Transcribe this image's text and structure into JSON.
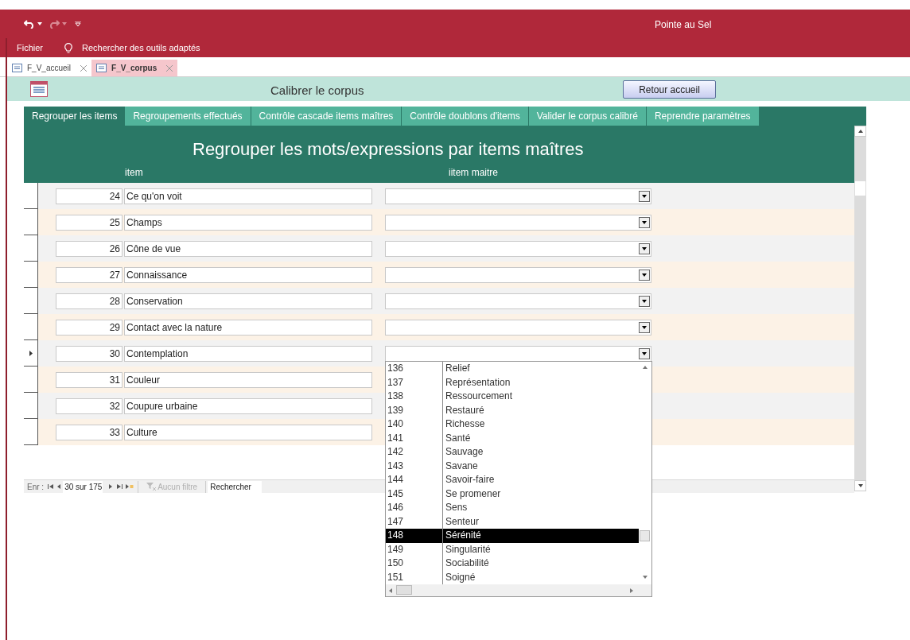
{
  "title_bar": {
    "title": "Pointe au Sel"
  },
  "ribbon": {
    "file_menu": "Fichier",
    "search_hint": "Rechercher des outils adaptés"
  },
  "document_tabs": [
    {
      "label": "F_V_accueil",
      "selected": false
    },
    {
      "label": "F_V_corpus",
      "selected": true
    }
  ],
  "form_header": {
    "title": "Calibrer le corpus",
    "button": "Retour accueil"
  },
  "tabs": [
    {
      "label": "Regrouper les items",
      "selected": true
    },
    {
      "label": "Regroupements effectués",
      "selected": false
    },
    {
      "label": "Contrôle cascade items maîtres",
      "selected": false
    },
    {
      "label": "Contrôle doublons d'items",
      "selected": false
    },
    {
      "label": "Valider le corpus calibré",
      "selected": false
    },
    {
      "label": "Reprendre paramètres",
      "selected": false
    }
  ],
  "form": {
    "title": "Regrouper les mots/expressions par items maîtres",
    "columns": [
      "item",
      "iitem maitre"
    ],
    "rows": [
      {
        "number": "24",
        "text": "Ce qu'on voit",
        "current": false
      },
      {
        "number": "25",
        "text": "Champs",
        "current": false
      },
      {
        "number": "26",
        "text": "Cône de vue",
        "current": false
      },
      {
        "number": "27",
        "text": "Connaissance",
        "current": false
      },
      {
        "number": "28",
        "text": "Conservation",
        "current": false
      },
      {
        "number": "29",
        "text": "Contact avec la nature",
        "current": false
      },
      {
        "number": "30",
        "text": "Contemplation",
        "current": true
      },
      {
        "number": "31",
        "text": "Couleur",
        "current": false
      },
      {
        "number": "32",
        "text": "Coupure urbaine",
        "current": false
      },
      {
        "number": "33",
        "text": "Culture",
        "current": false
      }
    ]
  },
  "dropdown": {
    "items": [
      {
        "number": "136",
        "text": "Relief",
        "selected": false
      },
      {
        "number": "137",
        "text": "Représentation",
        "selected": false
      },
      {
        "number": "138",
        "text": "Ressourcement",
        "selected": false
      },
      {
        "number": "139",
        "text": "Restauré",
        "selected": false
      },
      {
        "number": "140",
        "text": "Richesse",
        "selected": false
      },
      {
        "number": "141",
        "text": "Santé",
        "selected": false
      },
      {
        "number": "142",
        "text": "Sauvage",
        "selected": false
      },
      {
        "number": "143",
        "text": "Savane",
        "selected": false
      },
      {
        "number": "144",
        "text": "Savoir-faire",
        "selected": false
      },
      {
        "number": "145",
        "text": "Se promener",
        "selected": false
      },
      {
        "number": "146",
        "text": "Sens",
        "selected": false
      },
      {
        "number": "147",
        "text": "Senteur",
        "selected": false
      },
      {
        "number": "148",
        "text": "Sérénité",
        "selected": true
      },
      {
        "number": "149",
        "text": "Singularité",
        "selected": false
      },
      {
        "number": "150",
        "text": "Sociabilité",
        "selected": false
      },
      {
        "number": "151",
        "text": "Soigné",
        "selected": false
      }
    ]
  },
  "navigation": {
    "label": "Enr :",
    "position": "30 sur 175",
    "filter": "Aucun filtre",
    "search": "Rechercher"
  }
}
